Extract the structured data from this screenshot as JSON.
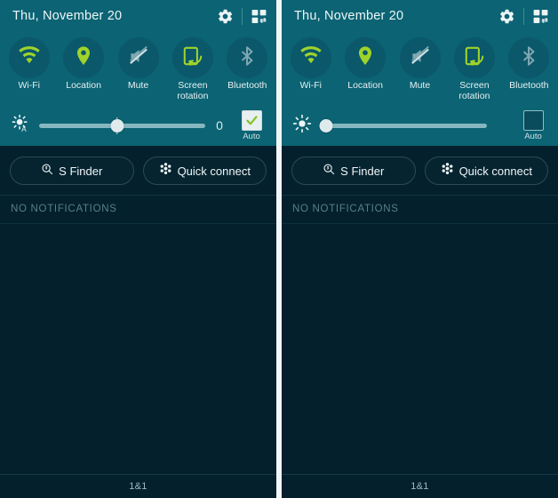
{
  "panels": [
    {
      "statusbar": {
        "date": "Thu, November 20",
        "settings_icon": "gear-icon",
        "edit_icon": "quick-settings-grid-icon"
      },
      "toggles": [
        {
          "label": "Wi-Fi",
          "icon": "wifi-icon",
          "active": true
        },
        {
          "label": "Location",
          "icon": "location-pin-icon",
          "active": true
        },
        {
          "label": "Mute",
          "icon": "mute-icon",
          "active": false
        },
        {
          "label": "Screen rotation",
          "icon": "screen-rotation-icon",
          "active": true
        },
        {
          "label": "Bluetooth",
          "icon": "bluetooth-icon",
          "active": false
        }
      ],
      "brightness": {
        "icon": "brightness-auto-icon",
        "value": "0",
        "show_value": true,
        "slider_percent": 47,
        "auto_label": "Auto",
        "auto_checked": true
      },
      "pills": [
        {
          "label": "S Finder",
          "icon": "s-finder-icon"
        },
        {
          "label": "Quick connect",
          "icon": "quick-connect-icon"
        }
      ],
      "notifications_empty": "NO NOTIFICATIONS",
      "carrier": "1&1"
    },
    {
      "statusbar": {
        "date": "Thu, November 20",
        "settings_icon": "gear-icon",
        "edit_icon": "quick-settings-grid-icon"
      },
      "toggles": [
        {
          "label": "Wi-Fi",
          "icon": "wifi-icon",
          "active": true
        },
        {
          "label": "Location",
          "icon": "location-pin-icon",
          "active": true
        },
        {
          "label": "Mute",
          "icon": "mute-icon",
          "active": false
        },
        {
          "label": "Screen rotation",
          "icon": "screen-rotation-icon",
          "active": true
        },
        {
          "label": "Bluetooth",
          "icon": "bluetooth-icon",
          "active": false
        }
      ],
      "brightness": {
        "icon": "brightness-icon",
        "value": "",
        "show_value": false,
        "slider_percent": 3,
        "auto_label": "Auto",
        "auto_checked": false
      },
      "pills": [
        {
          "label": "S Finder",
          "icon": "s-finder-icon"
        },
        {
          "label": "Quick connect",
          "icon": "quick-connect-icon"
        }
      ],
      "notifications_empty": "NO NOTIFICATIONS",
      "carrier": "1&1"
    }
  ],
  "colors": {
    "teal": "#0b6373",
    "dark": "#03202c",
    "active_green": "#9fd32b",
    "inactive_gray": "#6f9aa3",
    "text_light": "#eef6f7"
  }
}
